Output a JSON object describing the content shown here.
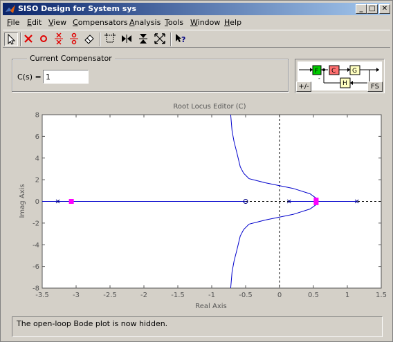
{
  "window": {
    "title": "SISO Design for System sys",
    "minimize": "_",
    "maximize": "□",
    "close": "✕"
  },
  "menu": [
    {
      "label": "File",
      "u": "F",
      "rest": "ile"
    },
    {
      "label": "Edit",
      "u": "E",
      "rest": "dit"
    },
    {
      "label": "View",
      "u": "V",
      "rest": "iew"
    },
    {
      "label": "Compensators",
      "u": "C",
      "rest": "ompensators"
    },
    {
      "label": "Analysis",
      "u": "A",
      "rest": "nalysis"
    },
    {
      "label": "Tools",
      "u": "T",
      "rest": "ools"
    },
    {
      "label": "Window",
      "u": "W",
      "rest": "indow"
    },
    {
      "label": "Help",
      "u": "H",
      "rest": "elp"
    }
  ],
  "toolbar": {
    "icons": [
      "pointer-icon",
      "delete-pole-icon",
      "add-zero-icon",
      "add-complex-pole-icon",
      "add-complex-zero-icon",
      "eraser-icon",
      "zoom-box-icon",
      "zoom-x-icon",
      "zoom-y-icon",
      "zoom-fit-icon",
      "whats-this-help-icon"
    ]
  },
  "compensator": {
    "legend": "Current Compensator",
    "label": "C(s) =",
    "value": "1"
  },
  "diagram": {
    "blocks": [
      "F",
      "C",
      "G",
      "H"
    ],
    "sign_button": "+/-",
    "fs_button": "FS",
    "colors": {
      "F": "#00cc00",
      "C": "#ff7070",
      "G": "#ffffc0",
      "H": "#ffffc0"
    }
  },
  "chart_data": {
    "type": "line",
    "title": "Root Locus Editor (C)",
    "xlabel": "Real Axis",
    "ylabel": "Imag Axis",
    "xlim": [
      -3.5,
      1.5
    ],
    "ylim": [
      -8,
      8
    ],
    "xticks": [
      "-3.5",
      "-3",
      "-2.5",
      "-2",
      "-1.5",
      "-1",
      "-0.5",
      "0",
      "0.5",
      "1",
      "1.5"
    ],
    "yticks": [
      "-8",
      "-6",
      "-4",
      "-2",
      "0",
      "2",
      "4",
      "6",
      "8"
    ],
    "grid": false,
    "colors": {
      "locus": "#0000cc",
      "closed_loop_pole": "#ff00ff",
      "axes": "#000000",
      "open_loop": "#000080"
    },
    "open_loop_poles": [
      [
        -3.27,
        0
      ],
      [
        0.14,
        0
      ],
      [
        1.14,
        0
      ]
    ],
    "open_loop_zeros": [
      [
        -0.5,
        0
      ]
    ],
    "closed_loop_poles": [
      [
        -3.07,
        0
      ],
      [
        0.54,
        0.12
      ],
      [
        0.54,
        -0.12
      ]
    ],
    "locus_branches": [
      {
        "name": "real-left",
        "points": [
          [
            -3.5,
            0
          ],
          [
            -0.5,
            0
          ]
        ]
      },
      {
        "name": "real-right",
        "points": [
          [
            0.14,
            0
          ],
          [
            1.14,
            0
          ]
        ]
      },
      {
        "name": "upper",
        "points": [
          [
            0.54,
            0
          ],
          [
            0.54,
            0.3
          ],
          [
            0.45,
            0.7
          ],
          [
            0.2,
            1.2
          ],
          [
            -0.2,
            1.7
          ],
          [
            -0.45,
            2.1
          ],
          [
            -0.53,
            2.6
          ],
          [
            -0.58,
            3.2
          ],
          [
            -0.63,
            4.5
          ],
          [
            -0.67,
            5.5
          ],
          [
            -0.7,
            6.5
          ],
          [
            -0.72,
            8
          ]
        ]
      },
      {
        "name": "lower",
        "points": [
          [
            0.54,
            0
          ],
          [
            0.54,
            -0.3
          ],
          [
            0.45,
            -0.7
          ],
          [
            0.2,
            -1.2
          ],
          [
            -0.2,
            -1.7
          ],
          [
            -0.45,
            -2.1
          ],
          [
            -0.53,
            -2.6
          ],
          [
            -0.58,
            -3.2
          ],
          [
            -0.63,
            -4.5
          ],
          [
            -0.67,
            -5.5
          ],
          [
            -0.7,
            -6.5
          ],
          [
            -0.72,
            -8
          ]
        ]
      }
    ]
  },
  "status": {
    "text": "The open-loop Bode plot is now hidden."
  }
}
